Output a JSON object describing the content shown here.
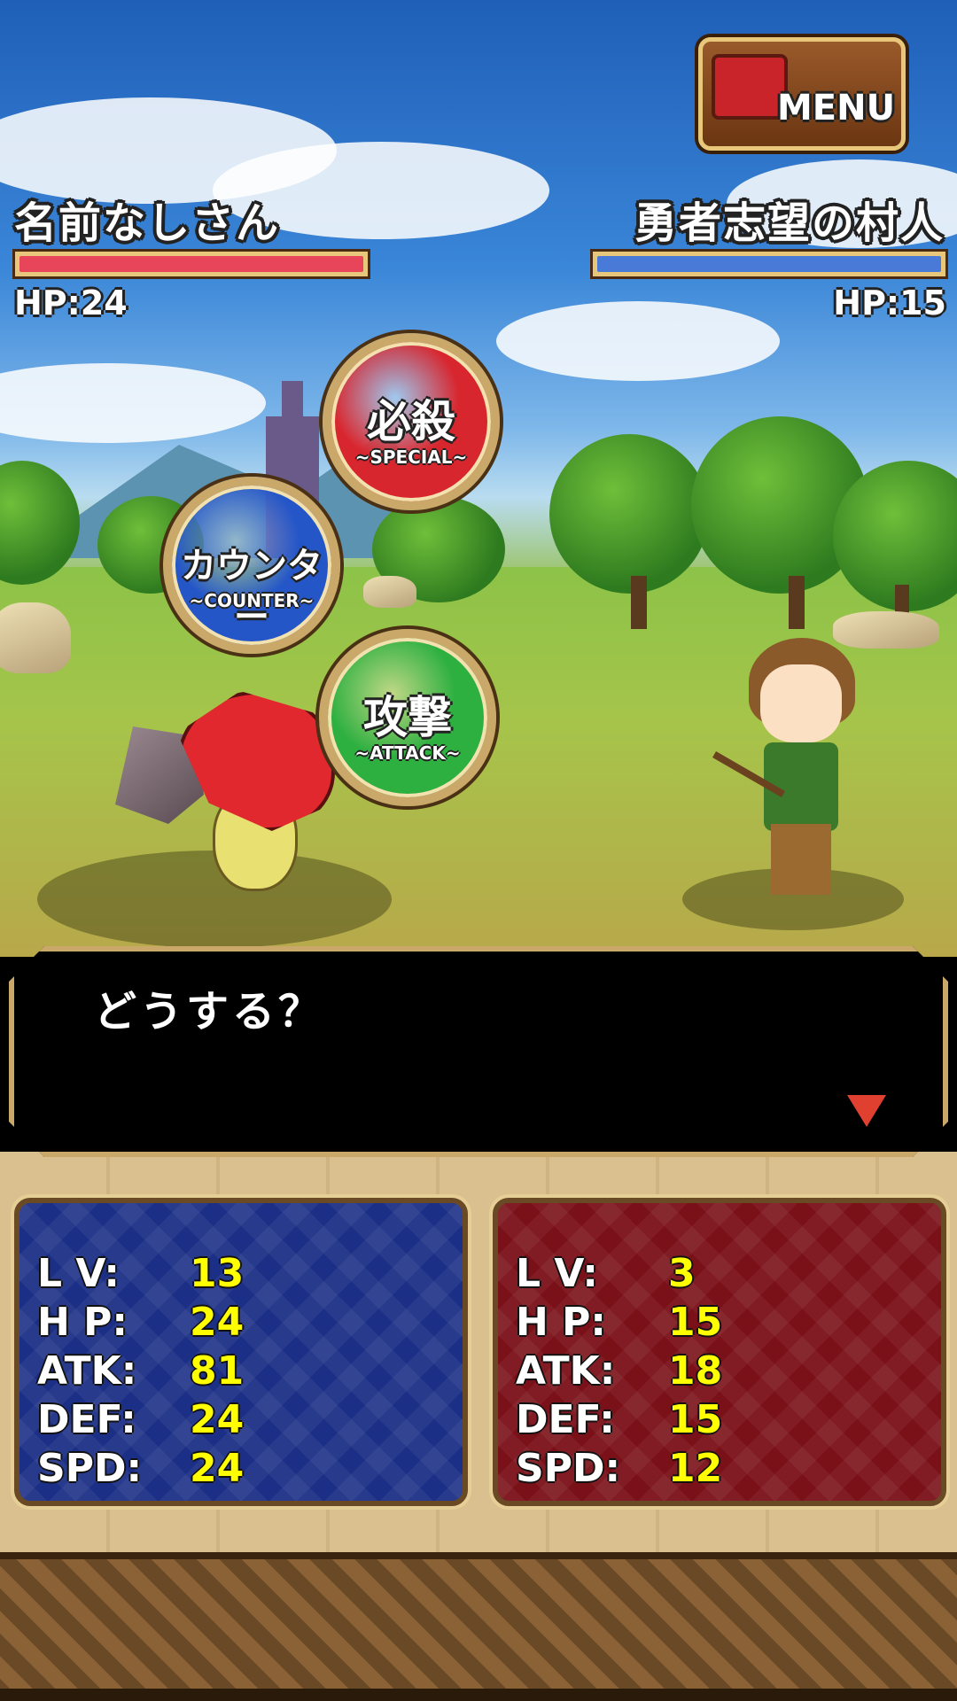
{
  "menu": {
    "label": "MENU"
  },
  "player": {
    "name": "名前なしさん",
    "hp_text": "HP:24",
    "hp_fraction": 1.0,
    "bar_color": "#e8455a"
  },
  "enemy": {
    "name": "勇者志望の村人",
    "hp_text": "HP:15",
    "hp_fraction": 1.0,
    "bar_color": "#4a7ad8"
  },
  "commands": {
    "special": {
      "jp": "必殺",
      "en": "~SPECIAL~",
      "color": "#d8262e"
    },
    "counter": {
      "jp": "カウンター",
      "en": "~COUNTER~",
      "color": "#2456c8"
    },
    "attack": {
      "jp": "攻撃",
      "en": "~ATTACK~",
      "color": "#2eb040"
    }
  },
  "dialog": {
    "message": "どうする？"
  },
  "player_stats": [
    {
      "label": "L V:",
      "value": "13"
    },
    {
      "label": "H P:",
      "value": "24"
    },
    {
      "label": "ATK:",
      "value": "81"
    },
    {
      "label": "DEF:",
      "value": "24"
    },
    {
      "label": "SPD:",
      "value": "24"
    }
  ],
  "enemy_stats": [
    {
      "label": "L V:",
      "value": "3"
    },
    {
      "label": "H P:",
      "value": "15"
    },
    {
      "label": "ATK:",
      "value": "18"
    },
    {
      "label": "DEF:",
      "value": "15"
    },
    {
      "label": "SPD:",
      "value": "12"
    }
  ]
}
